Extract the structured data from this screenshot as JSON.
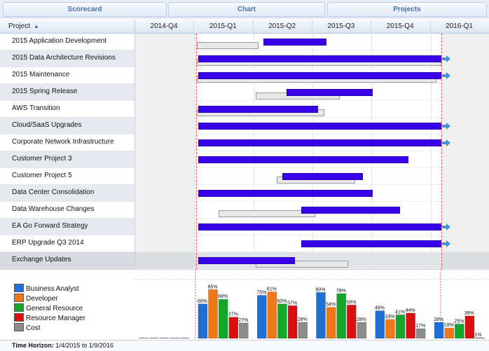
{
  "tabs": {
    "scorecard": "Scorecard",
    "chart": "Chart",
    "projects": "Projects"
  },
  "header": {
    "project_col": "Project",
    "sort_icon": "sort-ascending-icon",
    "quarters": [
      "2014-Q4",
      "2015-Q1",
      "2015-Q2",
      "2015-Q3",
      "2015-Q4",
      "2016-Q1"
    ]
  },
  "rows": [
    "2015 Application Development",
    "2015 Data Architecture Revisions",
    "2015 Maintenance",
    "2015 Spring Release",
    "AWS Transition",
    "Cloud/SaaS Upgrades",
    "Corporate Network Infrastructure",
    "Customer Project 3",
    "Customer Project 5",
    "Data Center Consolidation",
    "Data Warehouse Changes",
    "EA Go Forward Strategy",
    "ERP Upgrade Q3 2014",
    "Exchange Updates"
  ],
  "selected_row": "Exchange Updates",
  "colors": {
    "bar": "#3b00ea",
    "baseline": "#e8e8e8",
    "arrow": "#3d8fe0",
    "now_line": "#e15a5a",
    "tab_text": "#4a6fa5"
  },
  "chart_data": {
    "type": "bar",
    "categories": [
      "2014-Q4",
      "2015-Q1",
      "2015-Q2",
      "2015-Q3",
      "2015-Q4",
      "2016-Q1"
    ],
    "series": [
      {
        "name": "Business Analyst",
        "color": "#1e6fd6",
        "values": [
          0,
          60,
          75,
          80,
          48,
          28
        ]
      },
      {
        "name": "Developer",
        "color": "#f07818",
        "values": [
          0,
          85,
          81,
          54,
          33,
          18
        ]
      },
      {
        "name": "General Resource",
        "color": "#13a82a",
        "values": [
          0,
          68,
          60,
          78,
          41,
          25
        ]
      },
      {
        "name": "Resource Manager",
        "color": "#d81010",
        "values": [
          0,
          37,
          57,
          58,
          44,
          39
        ]
      },
      {
        "name": "Cost",
        "color": "#8c8c8c",
        "values": [
          0,
          27,
          28,
          28,
          17,
          1
        ]
      }
    ],
    "labels": [
      [
        null,
        null,
        null,
        null,
        null
      ],
      [
        "60%",
        "85%",
        "68%",
        "37%",
        "27%"
      ],
      [
        "75%",
        "81%",
        "60%",
        "57%",
        "28%"
      ],
      [
        "80%",
        "54%",
        "78%",
        "58%",
        "28%"
      ],
      [
        "48%",
        "33%",
        "41%",
        "44%",
        "17%"
      ],
      [
        "28%",
        "18%",
        "25%",
        "39%",
        "1%"
      ]
    ],
    "ylim": [
      0,
      100
    ]
  },
  "footer": {
    "label": "Time Horizon:",
    "value": "1/4/2015 to 1/9/2016"
  }
}
